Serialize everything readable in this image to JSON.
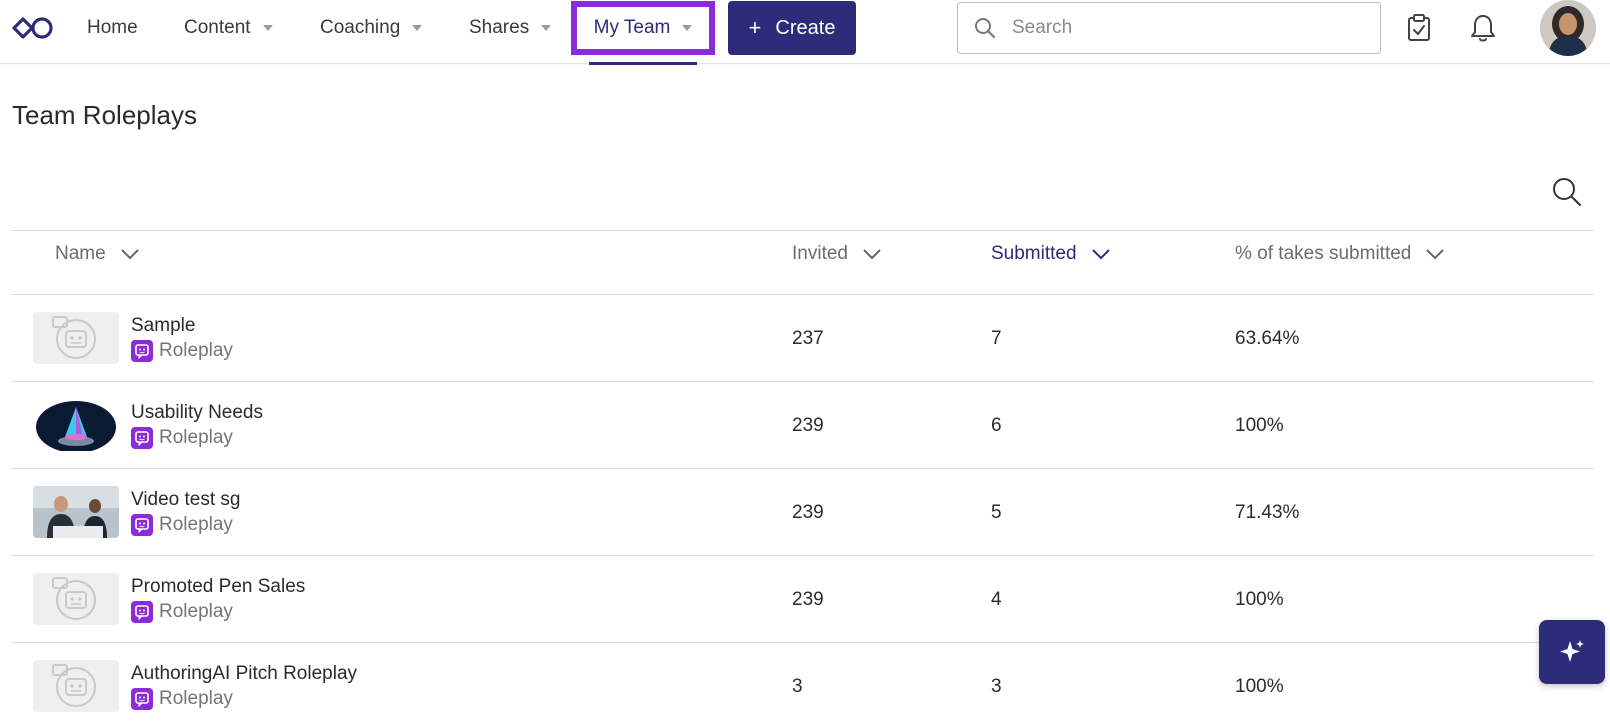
{
  "nav": {
    "items": [
      {
        "label": "Home",
        "has_caret": false
      },
      {
        "label": "Content",
        "has_caret": true
      },
      {
        "label": "Coaching",
        "has_caret": true
      },
      {
        "label": "Shares",
        "has_caret": true
      }
    ],
    "active": {
      "label": "My Team"
    },
    "create_label": "Create",
    "search_placeholder": "Search"
  },
  "page": {
    "title": "Team Roleplays"
  },
  "table": {
    "columns": [
      {
        "label": "Name"
      },
      {
        "label": "Invited"
      },
      {
        "label": "Submitted",
        "active": true
      },
      {
        "label": "% of takes submitted"
      }
    ],
    "rows": [
      {
        "name": "Sample",
        "type": "Roleplay",
        "invited": "237",
        "submitted": "7",
        "pct": "63.64%",
        "thumb": "placeholder-bot"
      },
      {
        "name": "Usability Needs",
        "type": "Roleplay",
        "invited": "239",
        "submitted": "6",
        "pct": "100%",
        "thumb": "crystal-image"
      },
      {
        "name": "Video test sg",
        "type": "Roleplay",
        "invited": "239",
        "submitted": "5",
        "pct": "71.43%",
        "thumb": "meeting-photo"
      },
      {
        "name": "Promoted Pen Sales",
        "type": "Roleplay",
        "invited": "239",
        "submitted": "4",
        "pct": "100%",
        "thumb": "placeholder-bot"
      },
      {
        "name": "AuthoringAI Pitch Roleplay",
        "type": "Roleplay",
        "invited": "3",
        "submitted": "3",
        "pct": "100%",
        "thumb": "placeholder-bot"
      }
    ]
  },
  "colors": {
    "brand": "#2c2c7a",
    "highlight": "#8b2bd9",
    "roleplay_badge": "#8b2bd9"
  }
}
